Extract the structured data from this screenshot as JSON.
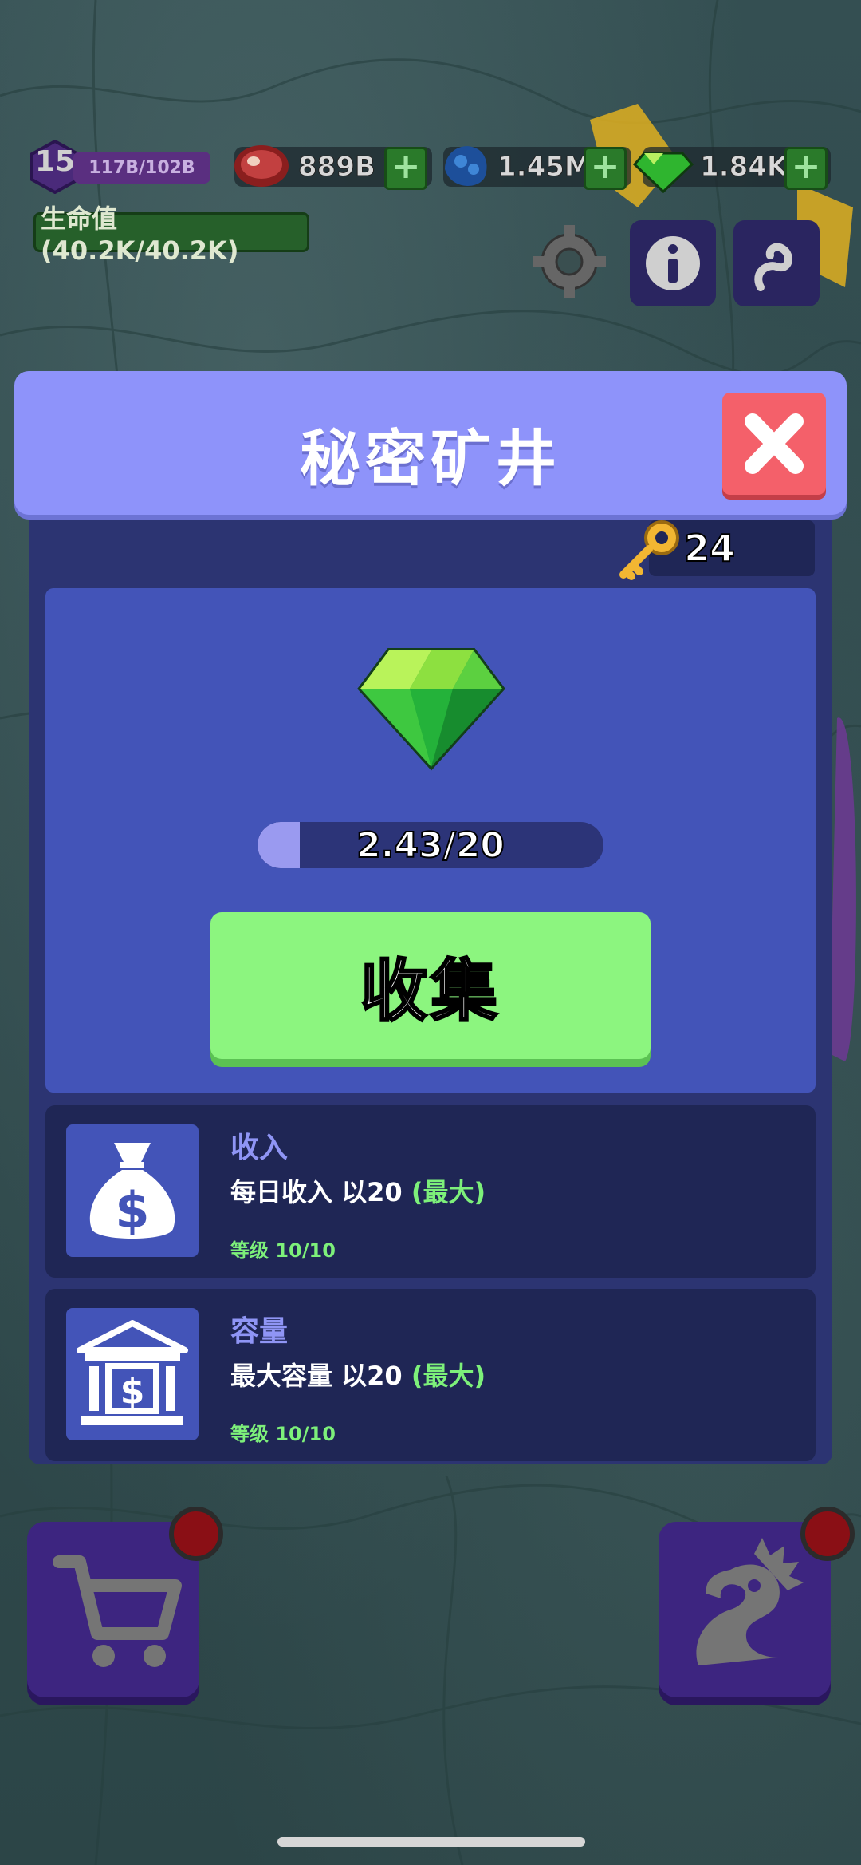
{
  "hud": {
    "level": "15",
    "xp": "117B/102B",
    "meat": "889B",
    "ore": "1.45M",
    "gems": "1.84K",
    "hp": "生命值 (40.2K/40.2K)"
  },
  "modal": {
    "title": "秘密矿井",
    "keys": "24",
    "progress_text": "2.43/20",
    "progress_value": 2.43,
    "progress_max": 20,
    "collect_label": "收集"
  },
  "upgrades": [
    {
      "title": "收入",
      "desc": "每日收入 以20",
      "max": " (最大)",
      "level": "等级 10/10",
      "icon": "money-bag-icon"
    },
    {
      "title": "容量",
      "desc": "最大容量 以20",
      "max": " (最大)",
      "level": "等级 10/10",
      "icon": "bank-icon"
    }
  ],
  "colors": {
    "header": "#8e93fa",
    "close": "#f4606a",
    "collect": "#8cf57f",
    "card": "#4354b8",
    "accent_green": "#7df07a"
  }
}
